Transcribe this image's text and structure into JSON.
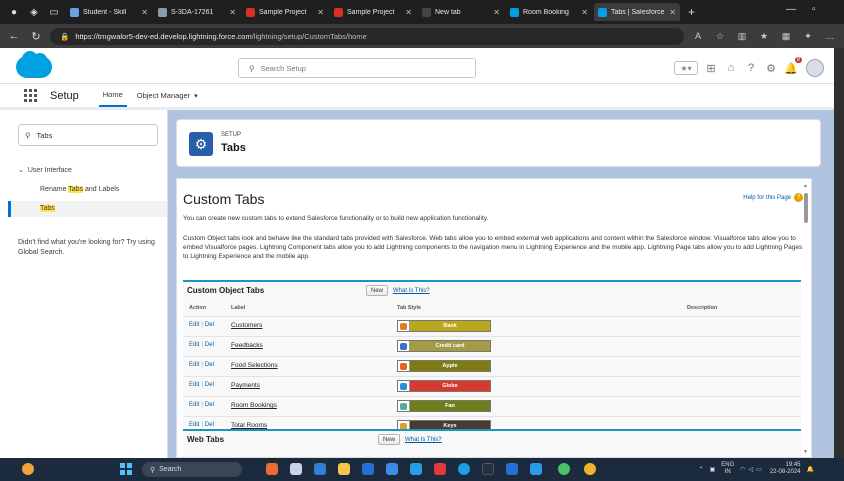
{
  "browser": {
    "tabs": [
      {
        "label": "Student - Skill",
        "fav": "#6ba2e3",
        "active": false
      },
      {
        "label": "S-3DA-17261",
        "fav": "#8a9bb0",
        "active": false
      },
      {
        "label": "Sample Project",
        "fav": "#d93025",
        "active": false
      },
      {
        "label": "Sample Project",
        "fav": "#d93025",
        "active": false
      },
      {
        "label": "New tab",
        "fav": "#444444",
        "active": false
      },
      {
        "label": "Room Booking",
        "fav": "#00a1e0",
        "active": false
      },
      {
        "label": "Tabs | Salesforce",
        "fav": "#00a1e0",
        "active": true
      }
    ],
    "url_host": "https://trngwalor5-dev-ed.develop.lightning.force.com",
    "url_path": "/lightning/setup/CustomTabs/home"
  },
  "header": {
    "search_placeholder": "Search Setup",
    "notification_count": "9"
  },
  "nav": {
    "app_title": "Setup",
    "home_tab": "Home",
    "object_manager_tab": "Object Manager"
  },
  "sidebar": {
    "quick_find_value": "Tabs",
    "parent_label": "User Interface",
    "child1_prefix": "Rename ",
    "child1_highlight": "Tabs",
    "child1_suffix": " and Labels",
    "child2_label": "Tabs",
    "not_found_text": "Didn't find what you're looking for? Try using Global Search."
  },
  "page_header": {
    "eyebrow": "SETUP",
    "title": "Tabs"
  },
  "main": {
    "title": "Custom Tabs",
    "help_link": "Help for this Page",
    "desc1": "You can create new custom tabs to extend Salesforce functionality or to build new application functionality.",
    "desc2": "Custom Object tabs look and behave like the standard tabs provided with Salesforce. Web tabs allow you to embed external web applications and content within the Salesforce window. Visualforce tabs allow you to embed Visualforce pages. Lightning Component tabs allow you to add Lightning components to the navigation menu in Lightning Experience and the mobile app. Lightning Page tabs allow you to add Lightning Pages to Lightning Experience and the mobile app.",
    "custom_object_tabs": {
      "title": "Custom Object Tabs",
      "new_button": "New",
      "what_link": "What Is This?",
      "columns": {
        "action": "Action",
        "label": "Label",
        "tab_style": "Tab Style",
        "description": "Description"
      },
      "rows": [
        {
          "edit": "Edit",
          "del": "Del",
          "label": "Customers",
          "style": "Bank",
          "color": "#b9a81c",
          "icon_color": "#e07b1f"
        },
        {
          "edit": "Edit",
          "del": "Del",
          "label": "Feedbacks",
          "style": "Credit card",
          "color": "#a49c45",
          "icon_color": "#3b72c4"
        },
        {
          "edit": "Edit",
          "del": "Del",
          "label": "Food Selections",
          "style": "Apple",
          "color": "#7e7a14",
          "icon_color": "#e0641f"
        },
        {
          "edit": "Edit",
          "del": "Del",
          "label": "Payments",
          "style": "Globe",
          "color": "#d63a2f",
          "icon_color": "#2c8fd6"
        },
        {
          "edit": "Edit",
          "del": "Del",
          "label": "Room Bookings",
          "style": "Fan",
          "color": "#6f7e1b",
          "icon_color": "#5aa6a0"
        },
        {
          "edit": "Edit",
          "del": "Del",
          "label": "Total Rooms",
          "style": "Keys",
          "color": "#4a3b31",
          "icon_color": "#d9a032"
        }
      ]
    },
    "web_tabs": {
      "title": "Web Tabs",
      "new_button": "New",
      "what_link": "What Is This?"
    }
  },
  "taskbar": {
    "search_label": "Search",
    "lang_top": "ENG",
    "lang_bottom": "IN",
    "time": "19:45",
    "date": "22-08-2024"
  }
}
